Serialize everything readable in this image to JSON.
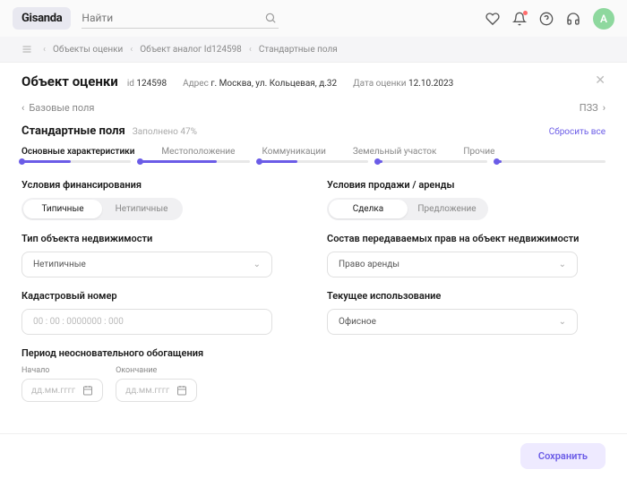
{
  "brand": "Gisanda",
  "search": {
    "placeholder": "Найти"
  },
  "avatar_letter": "A",
  "breadcrumbs": [
    "Объекты оценки",
    "Объект аналог Id124598",
    "Стандартные поля"
  ],
  "page": {
    "title": "Объект оценки",
    "id_label": "id",
    "id": "124598",
    "addr_label": "Адрес",
    "addr": "г. Москва, ул. Кольцевая, д.32",
    "date_label": "Дата оценки",
    "date": "12.10.2023"
  },
  "nav": {
    "back": "Базовые поля",
    "fwd": "ПЗЗ"
  },
  "section": {
    "title": "Стандартные поля",
    "sub": "Заполнено 47%",
    "reset": "Сбросить все"
  },
  "tabs": [
    "Основные характеристики",
    "Местоположение",
    "Коммуникации",
    "Земельный участок",
    "Прочие"
  ],
  "fields": {
    "financing": {
      "label": "Условия финансирования",
      "opt1": "Типичные",
      "opt2": "Нетипичные"
    },
    "sale": {
      "label": "Условия продажи / аренды",
      "opt1": "Сделка",
      "opt2": "Предложение"
    },
    "type": {
      "label": "Тип объекта недвижимости",
      "value": "Нетипичные"
    },
    "rights": {
      "label": "Состав передаваемых прав на объект недвижимости",
      "value": "Право аренды"
    },
    "cadastral": {
      "label": "Кадастровый номер",
      "placeholder": "00 : 00 : 0000000 : 000"
    },
    "usage": {
      "label": "Текущее использование",
      "value": "Офисное"
    },
    "enrichment": {
      "label": "Период неосновательного обогащения",
      "start": "Начало",
      "end": "Окончание",
      "placeholder": "дд.мм.гггг"
    }
  },
  "save": "Сохранить"
}
